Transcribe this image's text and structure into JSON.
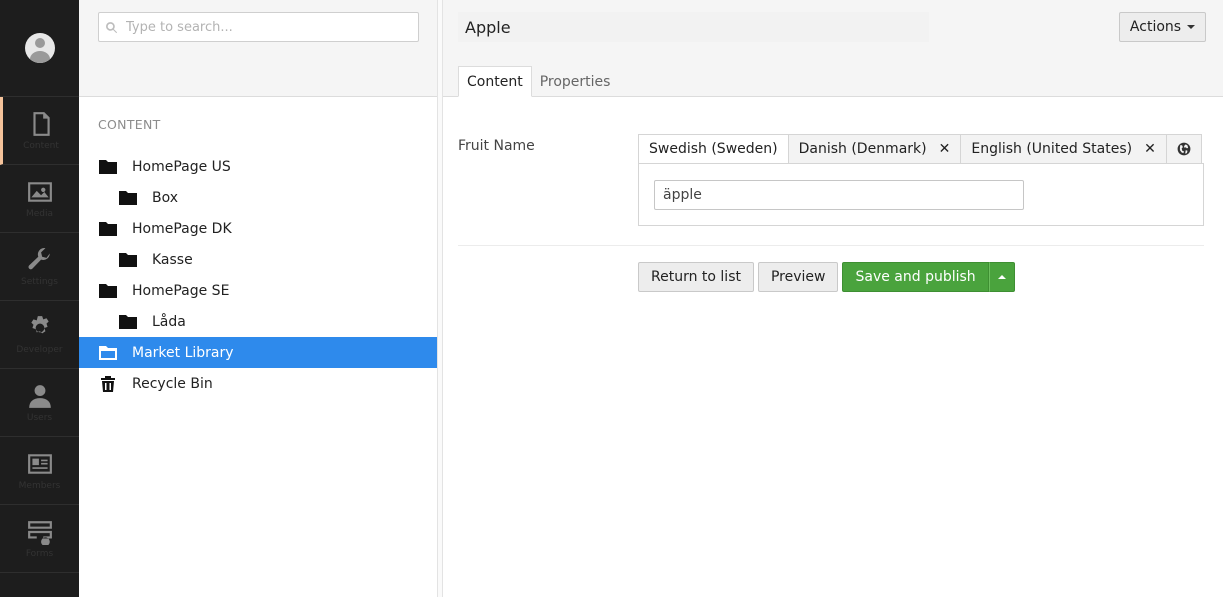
{
  "app_nav": {
    "items": [
      {
        "icon": "document-icon",
        "label": "Content",
        "active": true
      },
      {
        "icon": "image-icon",
        "label": "Media"
      },
      {
        "icon": "wrench-icon",
        "label": "Settings"
      },
      {
        "icon": "gear-icon",
        "label": "Developer"
      },
      {
        "icon": "user-icon",
        "label": "Users"
      },
      {
        "icon": "id-card-icon",
        "label": "Members"
      },
      {
        "icon": "form-icon",
        "label": "Forms"
      }
    ]
  },
  "tree": {
    "search_placeholder": "Type to search...",
    "section_title": "CONTENT",
    "nodes": [
      {
        "label": "HomePage US",
        "icon": "folder-icon"
      },
      {
        "label": "Box",
        "icon": "folder-icon"
      },
      {
        "label": "HomePage DK",
        "icon": "folder-icon"
      },
      {
        "label": "Kasse",
        "icon": "folder-icon"
      },
      {
        "label": "HomePage SE",
        "icon": "folder-icon"
      },
      {
        "label": "Låda",
        "icon": "folder-icon"
      },
      {
        "label": "Market Library",
        "icon": "folder-open-icon",
        "selected": true
      },
      {
        "label": "Recycle Bin",
        "icon": "trash-icon"
      }
    ]
  },
  "editor": {
    "node_name": "Apple",
    "actions_label": "Actions",
    "tabs": [
      {
        "label": "Content",
        "active": true
      },
      {
        "label": "Properties"
      }
    ],
    "property": {
      "label": "Fruit Name",
      "languages": [
        {
          "label": "Swedish (Sweden)",
          "active": true
        },
        {
          "label": "Danish (Denmark)",
          "closable": true
        },
        {
          "label": "English (United States)",
          "closable": true
        }
      ],
      "value": "äpple"
    },
    "buttons": {
      "return_label": "Return to list",
      "preview_label": "Preview",
      "save_publish_label": "Save and publish"
    }
  },
  "colors": {
    "nav_bg": "#1d1d1d",
    "selected_bg": "#2e8aec",
    "publish_green": "#4aa33d"
  }
}
